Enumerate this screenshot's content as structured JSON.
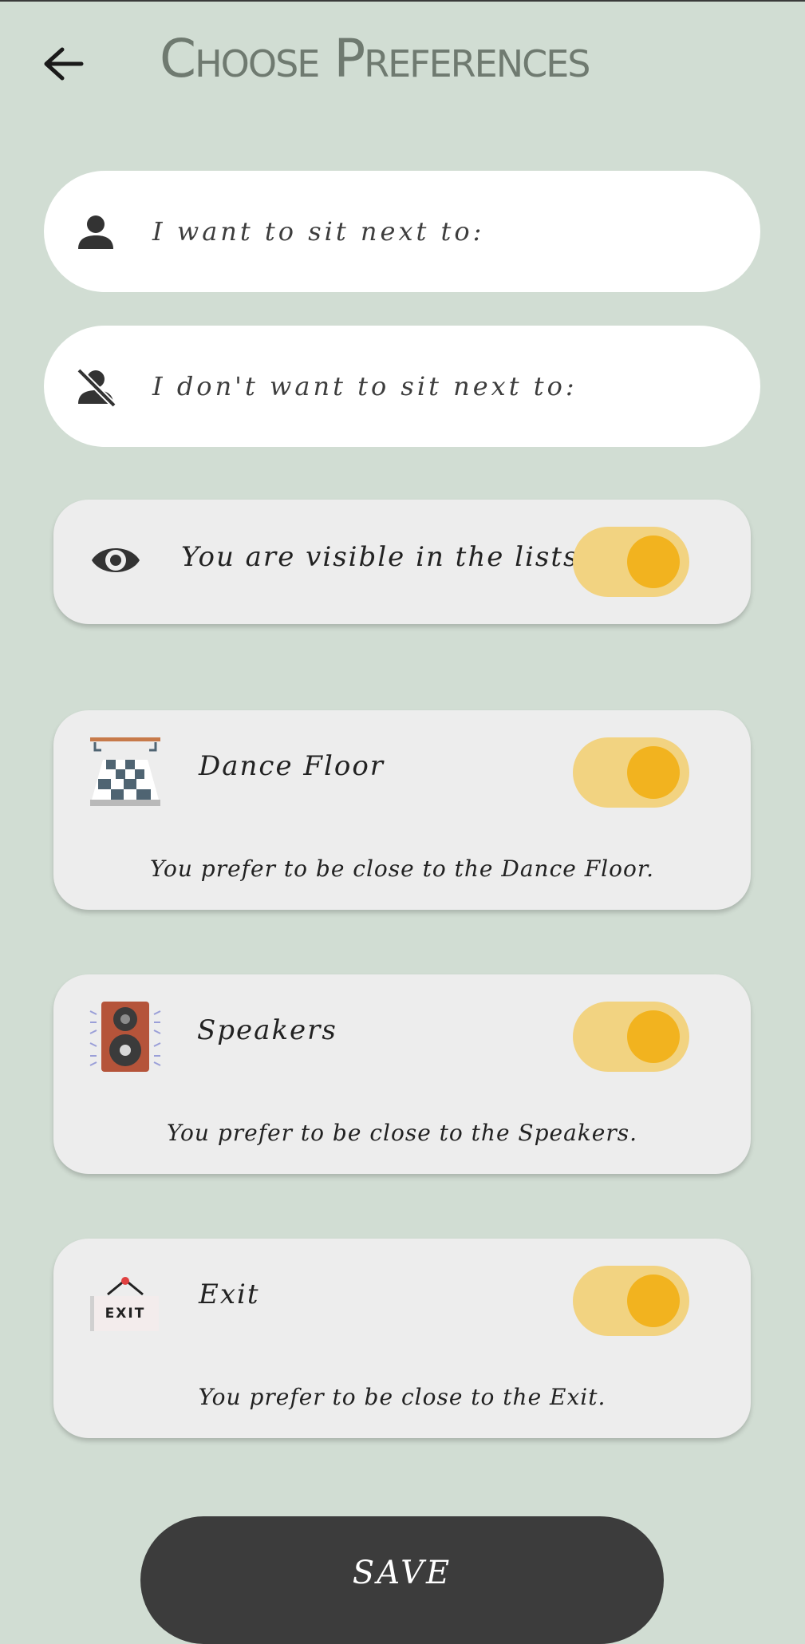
{
  "header": {
    "title": "Choose Preferences",
    "back_icon": "arrow-left-icon"
  },
  "preferences_inputs": [
    {
      "label": "I want to sit next to:",
      "icon": "person-icon"
    },
    {
      "label": "I don't want to sit next to:",
      "icon": "person-off-icon"
    }
  ],
  "visibility": {
    "label": "You are visible in the lists",
    "icon": "eye-icon",
    "enabled": true
  },
  "proximity": [
    {
      "title": "Dance Floor",
      "description": "You prefer to be close to the Dance Floor.",
      "icon": "dance-floor-icon",
      "enabled": true
    },
    {
      "title": "Speakers",
      "description": "You prefer to be close to the Speakers.",
      "icon": "speaker-icon",
      "enabled": true
    },
    {
      "title": "Exit",
      "description": "You prefer to be close to the Exit.",
      "icon": "exit-sign-icon",
      "icon_text": "EXIT",
      "enabled": true
    }
  ],
  "save_button": {
    "label": "SAVE"
  },
  "colors": {
    "background": "#d1ddd3",
    "toggle_track": "#f2d381",
    "toggle_knob": "#f2b31f",
    "save_button": "#3c3c3c"
  }
}
